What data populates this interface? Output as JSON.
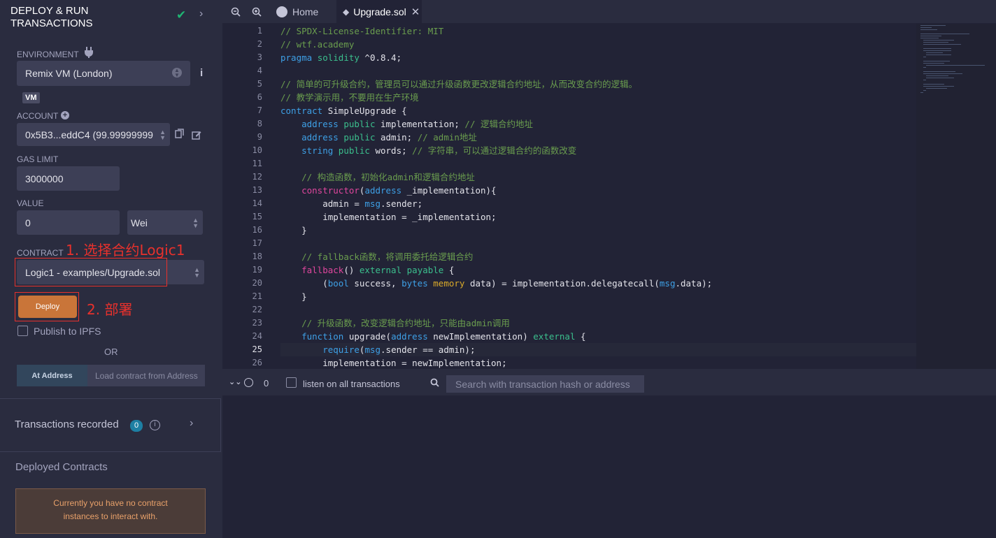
{
  "panel": {
    "title": "DEPLOY & RUN TRANSACTIONS",
    "environment_label": "ENVIRONMENT",
    "environment_value": "Remix VM (London)",
    "vm_badge": "VM",
    "account_label": "ACCOUNT",
    "account_value": "0x5B3...eddC4 (99.99999999",
    "gas_label": "GAS LIMIT",
    "gas_value": "3000000",
    "value_label": "VALUE",
    "value_amount": "0",
    "value_unit": "Wei",
    "contract_label": "CONTRACT",
    "contract_value": "Logic1 - examples/Upgrade.sol",
    "annotation_1": "1. 选择合约Logic1",
    "annotation_2": "2. 部署",
    "deploy_label": "Deploy",
    "publish_label": "Publish to IPFS",
    "or_label": "OR",
    "at_address_label": "At Address",
    "load_address_placeholder": "Load contract from Address",
    "transactions_label": "Transactions recorded",
    "transactions_count": "0",
    "deployed_label": "Deployed Contracts",
    "no_contract_line1": "Currently you have no contract",
    "no_contract_line2": "instances to interact with."
  },
  "tabs": {
    "home": "Home",
    "active": "Upgrade.sol"
  },
  "code_lines": [
    "// SPDX-License-Identifier: MIT",
    "// wtf.academy",
    "pragma solidity ^0.8.4;",
    "",
    "// 简单的可升级合约，管理员可以通过升级函数更改逻辑合约地址，从而改变合约的逻辑。",
    "// 教学演示用，不要用在生产环境",
    "contract SimpleUpgrade {",
    "    address public implementation; // 逻辑合约地址",
    "    address public admin; // admin地址",
    "    string public words; // 字符串，可以通过逻辑合约的函数改变",
    "",
    "    // 构造函数，初始化admin和逻辑合约地址",
    "    constructor(address _implementation){",
    "        admin = msg.sender;",
    "        implementation = _implementation;",
    "    }",
    "",
    "    // fallback函数，将调用委托给逻辑合约",
    "    fallback() external payable {",
    "        (bool success, bytes memory data) = implementation.delegatecall(msg.data);",
    "    }",
    "",
    "    // 升级函数，改变逻辑合约地址，只能由admin调用",
    "    function upgrade(address newImplementation) external {",
    "        require(msg.sender == admin);",
    "        implementation = newImplementation;"
  ],
  "line_numbers": [
    "1",
    "2",
    "3",
    "4",
    "5",
    "6",
    "7",
    "8",
    "9",
    "10",
    "11",
    "12",
    "13",
    "14",
    "15",
    "16",
    "17",
    "18",
    "19",
    "20",
    "21",
    "22",
    "23",
    "24",
    "25",
    "26"
  ],
  "terminal": {
    "count": "0",
    "listen_label": "listen on all transactions",
    "search_placeholder": "Search with transaction hash or address"
  },
  "colors": {
    "accent_deploy": "#c97539",
    "annotation_red": "#e8312c",
    "check_green": "#1fb573"
  }
}
